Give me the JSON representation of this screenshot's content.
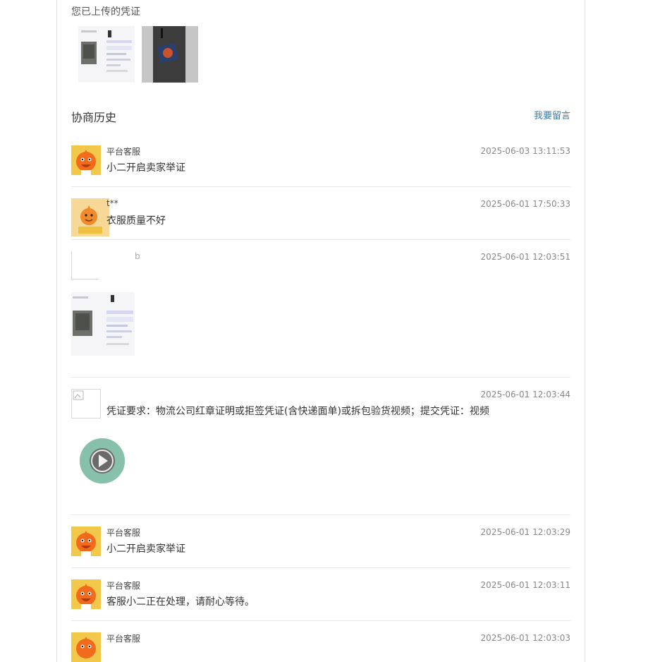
{
  "uploaded": {
    "title": "您已上传的凭证"
  },
  "history": {
    "title": "协商历史",
    "leave_message": "我要留言",
    "entries": [
      {
        "author": "平台客服",
        "time": "2025-06-03 13:11:53",
        "message": "小二开启卖家举证"
      },
      {
        "author": "t**",
        "time": "2025-06-01 17:50:33",
        "message": "衣服质量不好"
      },
      {
        "author": "b",
        "time": "2025-06-01 12:03:51",
        "message": ""
      },
      {
        "author": "",
        "time": "2025-06-01 12:03:44",
        "message": "凭证要求：物流公司红章证明或拒签凭证(含快递面单)或拆包验货视频；提交凭证：视频"
      },
      {
        "author": "平台客服",
        "time": "2025-06-01 12:03:29",
        "message": "小二开启卖家举证"
      },
      {
        "author": "平台客服",
        "time": "2025-06-01 12:03:11",
        "message": "客服小二正在处理，请耐心等待。"
      },
      {
        "author": "平台客服",
        "time": "2025-06-01 12:03:03",
        "message": ""
      }
    ]
  },
  "icons": {
    "mascot": "mascot-avatar-icon",
    "play": "play-icon"
  }
}
